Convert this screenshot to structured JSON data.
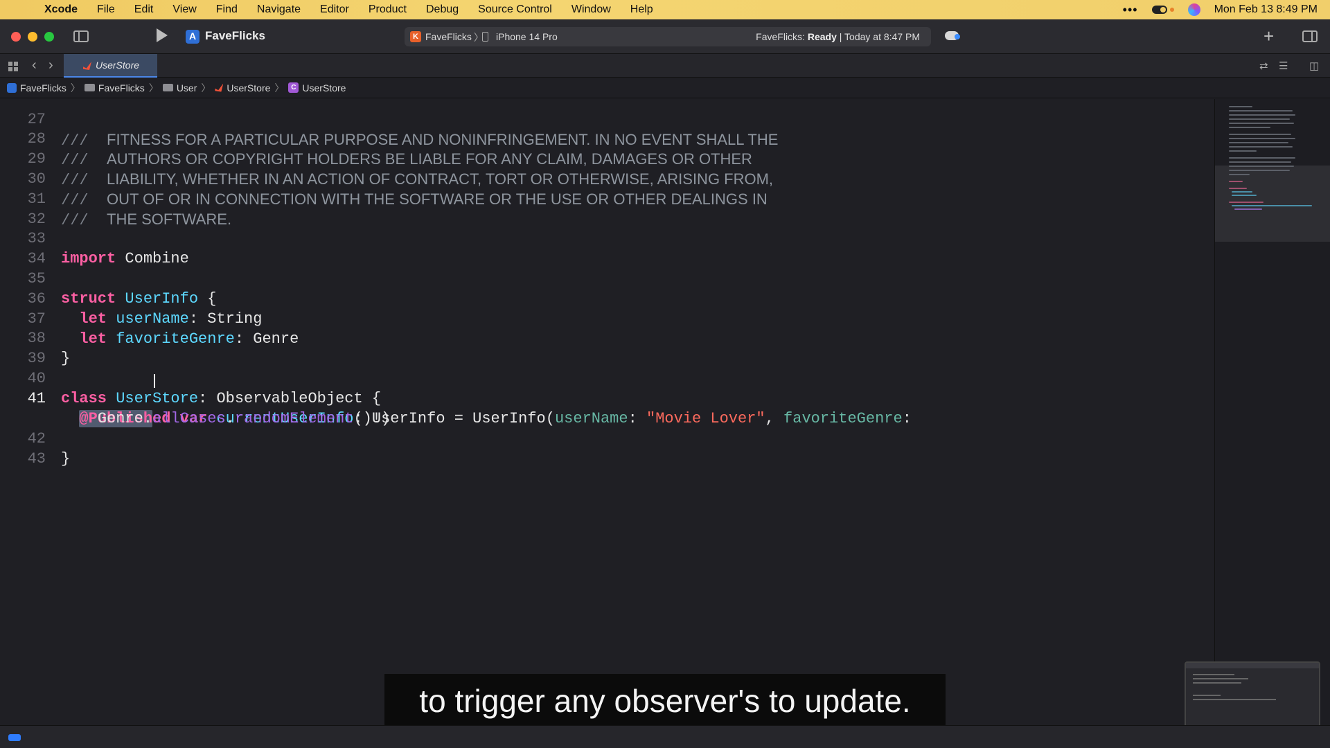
{
  "menubar": {
    "app_name": "Xcode",
    "items": [
      "File",
      "Edit",
      "View",
      "Find",
      "Navigate",
      "Editor",
      "Product",
      "Debug",
      "Source Control",
      "Window",
      "Help"
    ],
    "status_dots": "•••",
    "clock": "Mon Feb 13  8:49 PM"
  },
  "toolbar": {
    "project_title": "FaveFlicks",
    "scheme_icon_letter": "K",
    "scheme": "FaveFlicks",
    "device": "iPhone 14 Pro",
    "activity_prefix": "FaveFlicks:",
    "activity_status": "Ready",
    "activity_time": "| Today at 8:47 PM",
    "add_label": "+"
  },
  "tabbar": {
    "active_tab": "UserStore"
  },
  "breadcrumb": {
    "items": [
      "FaveFlicks",
      "FaveFlicks",
      "User",
      "UserStore",
      "UserStore"
    ],
    "class_icon_letter": "C"
  },
  "editor": {
    "lines": [
      {
        "n": "27",
        "text": "FITNESS FOR A PARTICULAR PURPOSE AND NONINFRINGEMENT. IN NO EVENT SHALL THE"
      },
      {
        "n": "28",
        "text": "AUTHORS OR COPYRIGHT HOLDERS BE LIABLE FOR ANY CLAIM, DAMAGES OR OTHER"
      },
      {
        "n": "29",
        "text": "LIABILITY, WHETHER IN AN ACTION OF CONTRACT, TORT OR OTHERWISE, ARISING FROM,"
      },
      {
        "n": "30",
        "text": "OUT OF OR IN CONNECTION WITH THE SOFTWARE OR THE USE OR OTHER DEALINGS IN"
      },
      {
        "n": "31",
        "text": "THE SOFTWARE."
      },
      {
        "n": "32"
      },
      {
        "n": "33"
      },
      {
        "n": "34"
      },
      {
        "n": "35"
      },
      {
        "n": "36"
      },
      {
        "n": "37"
      },
      {
        "n": "38"
      },
      {
        "n": "39"
      },
      {
        "n": "40"
      },
      {
        "n": "41"
      },
      {
        "n": "42"
      },
      {
        "n": "43"
      }
    ],
    "doc_comment_marker": "///",
    "tokens": {
      "import_kw": "import",
      "combine": "Combine",
      "struct_kw": "struct",
      "userinfo_type": "UserInfo",
      "open_brace": "{",
      "close_brace": "}",
      "let_kw": "let",
      "username_prop": "userName",
      "colon": ":",
      "string_type": "String",
      "favoritegenre_prop": "favoriteGenre",
      "genre_type": "Genre",
      "class_kw": "class",
      "userstore_type": "UserStore",
      "observable": "ObservableObject",
      "published_selected": "@Publish",
      "published_rest": "ed",
      "var_kw": "var",
      "currentuserinfo": "currentUserInfo",
      "equals": " = ",
      "userinfo_call": "UserInfo(",
      "username_label": "userName",
      "movie_lover": "\"Movie Lover\"",
      "comma": ", ",
      "favoritegenre_label": "favoriteGenre",
      "genre_name": "Genre",
      "dot": ".",
      "allcases": "allCases",
      "random_element": "randomElement",
      "tail": "()!)"
    }
  },
  "caption": "to trigger any observer's to update.",
  "colors": {
    "keyword": "#fc5fa3",
    "type": "#5dd8ff",
    "string": "#fc6a5d",
    "member": "#a167e6",
    "accent": "#2f7dff"
  }
}
